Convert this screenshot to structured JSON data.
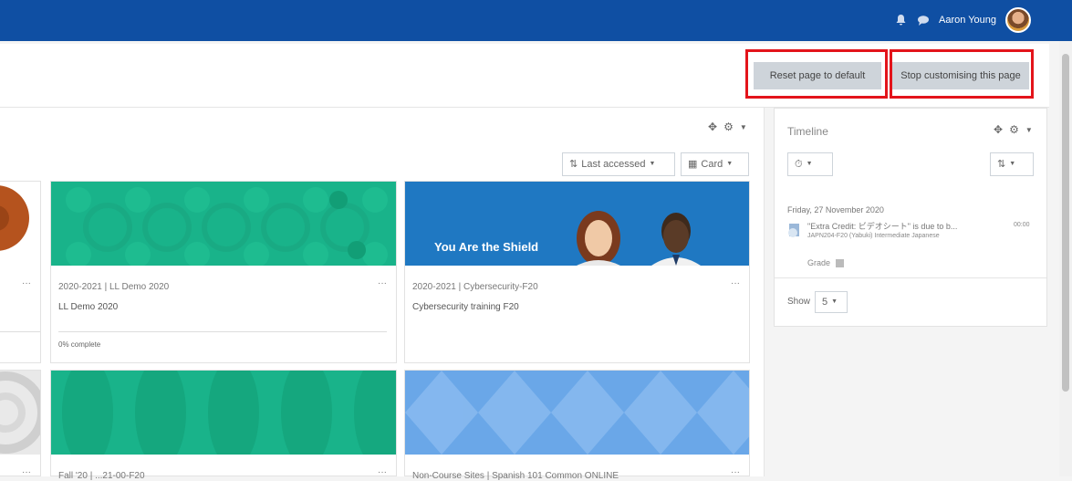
{
  "navbar": {
    "bell_icon": "bell-icon",
    "chat_icon": "chat-icon",
    "user_name": "Aaron Young"
  },
  "header": {
    "reset_label": "Reset page to default",
    "stop_label": "Stop customising this page"
  },
  "courses": {
    "sort_label": "Last accessed",
    "view_label": "Card",
    "cards": [
      {
        "category": "2020-2021 | LL Demo 2020",
        "name": "LL Demo 2020",
        "progress": "0% complete"
      },
      {
        "category": "2020-2021 | Cybersecurity-F20",
        "name": "Cybersecurity training F20",
        "banner": "You Are the Shield"
      },
      {
        "category": "Fall '20 | ...21-00-F20"
      },
      {
        "category": "Non-Course Sites | Spanish 101 Common ONLINE"
      }
    ]
  },
  "timeline": {
    "title": "Timeline",
    "date": "Friday, 27 November 2020",
    "event": "\"Extra Credit: ビデオシート\" is due to b...",
    "course": "JAPN204-F20 (Yabuki) Intermediate Japanese",
    "time": "00:00",
    "grade": "Grade",
    "show_label": "Show",
    "show_value": "5"
  },
  "colors": {
    "navbar": "#0f4fa3",
    "teal": "#19b38a",
    "blue": "#1f78c2",
    "highlight": "#e3141b"
  }
}
